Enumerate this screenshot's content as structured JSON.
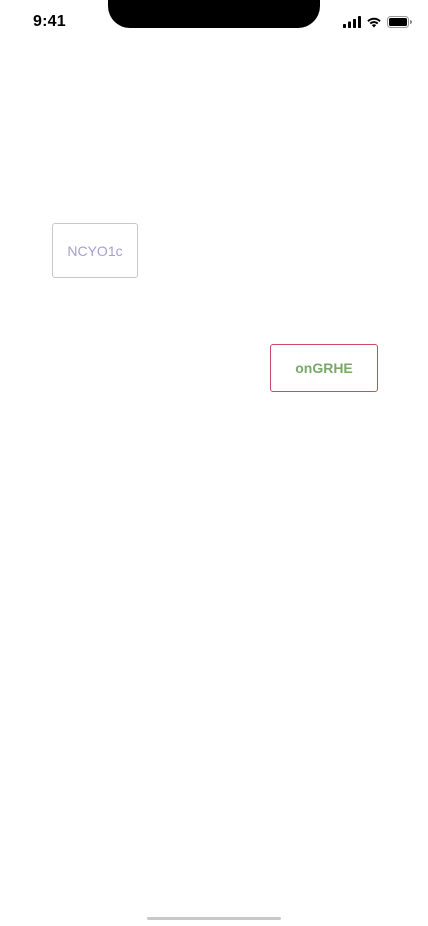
{
  "status_bar": {
    "time": "9:41",
    "icons": [
      "cellular-signal-icon",
      "wifi-icon",
      "battery-icon"
    ]
  },
  "buttons": {
    "first": {
      "label": "NCYO1c",
      "text_color": "#a49fd0",
      "border_color": "#c9c9c9"
    },
    "second": {
      "label": "onGRHE",
      "text_color": "#7aa86a",
      "border_color": "#cf4a63"
    }
  }
}
